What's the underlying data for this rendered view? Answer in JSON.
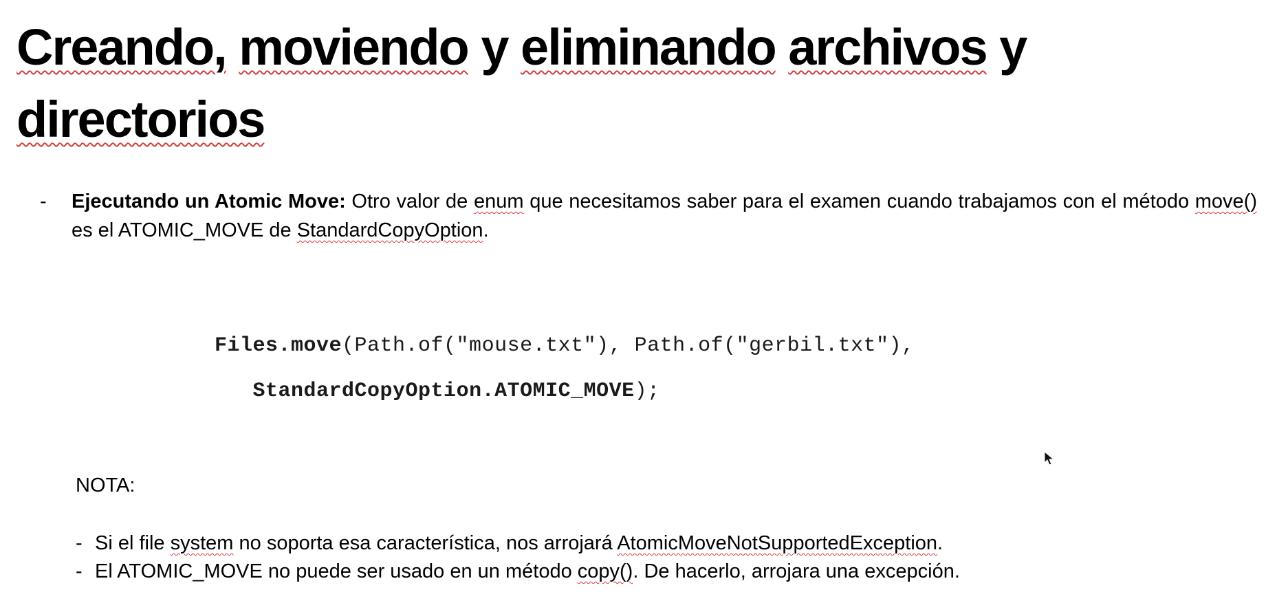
{
  "title": {
    "words": [
      "Creando,",
      "moviendo",
      "y",
      "eliminando",
      "archivos",
      "y",
      "directorios"
    ]
  },
  "bullet": {
    "dash": "-",
    "bold_label": "Ejecutando un Atomic Move:",
    "text_part1": " Otro valor de ",
    "enum_word": "enum",
    "text_part2": " que necesitamos saber para el examen cuando trabajamos con el método ",
    "move_word": "move()",
    "text_part3": " es el ATOMIC_MOVE de ",
    "class_word": "StandardCopyOption",
    "text_part4": "."
  },
  "code": {
    "line1_kw": "Files.move",
    "line1_rest": "(Path.of(\"mouse.txt\"), Path.of(\"gerbil.txt\"),",
    "line2_kw": "StandardCopyOption.ATOMIC_MOVE",
    "line2_rest": ");"
  },
  "note": {
    "label": "NOTA:",
    "items": [
      {
        "dash": "-",
        "pre": "Si el file ",
        "squig1": "system",
        "mid": " no soporta esa característica, nos arrojará ",
        "squig2": "AtomicMoveNotSupportedException",
        "post": "."
      },
      {
        "dash": "-",
        "pre": "El ATOMIC_MOVE no puede ser usado en un método ",
        "squig1": "copy()",
        "post": ". De hacerlo, arrojara una excepción."
      }
    ]
  }
}
